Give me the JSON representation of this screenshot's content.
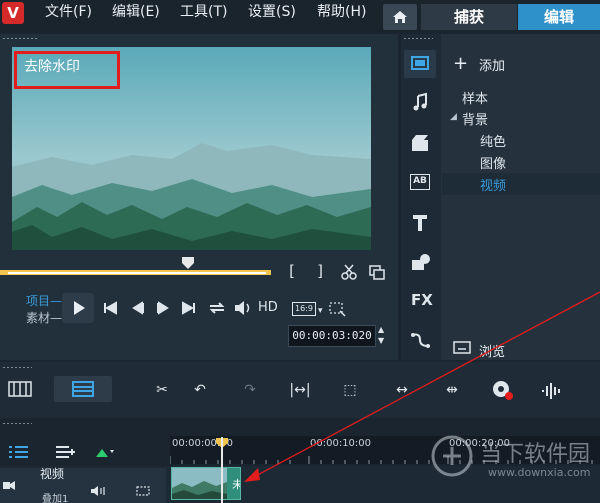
{
  "menu": {
    "items": [
      "文件(F)",
      "编辑(E)",
      "工具(T)",
      "设置(S)",
      "帮助(H)"
    ],
    "capture_tab": "捕获",
    "edit_tab": "编辑"
  },
  "preview": {
    "watermark_text": "去除水印",
    "mode_project": "项目",
    "mode_clip": "素材",
    "hd_label": "HD",
    "aspect_label": "16:9",
    "timecode": "00:00:03:020",
    "trim_in": "[",
    "trim_out": "]"
  },
  "library": {
    "add_label": "添加",
    "tree": {
      "samples": "样本",
      "background": "背景",
      "solid_color": "纯色",
      "image": "图像",
      "video": "视频"
    },
    "browse_label": "浏览",
    "fx_label": "FX",
    "ab_label": "AB"
  },
  "timeline": {
    "ruler_ticks": [
      "00:00:00:00",
      "00:00:10:00",
      "00:00:20:00"
    ],
    "track_name": "视频",
    "track_sub": "叠加1",
    "clip_label": "未"
  },
  "site_watermark": {
    "name": "当下软件园",
    "url": "www.downxia.com"
  },
  "colors": {
    "accent": "#2f91c9",
    "trim": "#f1c550",
    "highlight_box": "#e31c1c",
    "selected_text": "#3a9ad9"
  }
}
